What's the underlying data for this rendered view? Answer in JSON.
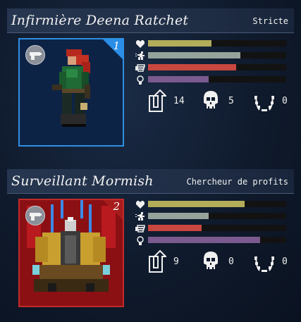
{
  "colors": {
    "health": "#b3ad5a",
    "speed": "#95a39a",
    "attack": "#c8473f",
    "resolve": "#7a5a8f"
  },
  "cards": [
    {
      "name": "Infirmière Deena Ratchet",
      "trait": "Stricte",
      "slot": "1",
      "portrait_frame": "blue",
      "stats": {
        "health": 0.46,
        "speed": 0.67,
        "attack": 0.64,
        "resolve": 0.44
      },
      "counters": {
        "promotions": "14",
        "kills": "5",
        "laurels": "0"
      }
    },
    {
      "name": "Surveillant Mormish",
      "trait": "Chercheur de profits",
      "slot": "2",
      "portrait_frame": "red",
      "stats": {
        "health": 0.7,
        "speed": 0.44,
        "attack": 0.39,
        "resolve": 0.81
      },
      "counters": {
        "promotions": "9",
        "kills": "0",
        "laurels": "0"
      }
    }
  ],
  "icons": {
    "health": "heart-icon",
    "speed": "running-icon",
    "attack": "fist-icon",
    "resolve": "resolve-icon",
    "promotions": "promotion-arrow-icon",
    "kills": "skull-icon",
    "laurels": "laurel-icon",
    "weapon": "gun-icon"
  }
}
